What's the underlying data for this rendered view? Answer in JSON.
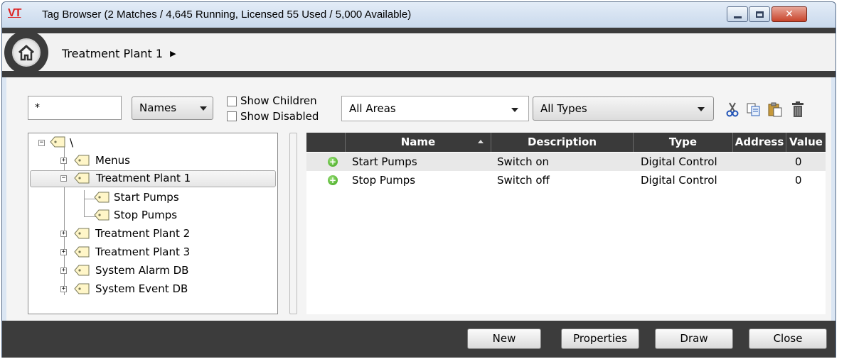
{
  "window": {
    "logo": "VT",
    "title": "Tag Browser (2 Matches / 4,645 Running, Licensed 55 Used / 5,000 Available)",
    "close_glyph": "✕"
  },
  "breadcrumb": {
    "items": [
      "Treatment Plant 1"
    ],
    "arrow": "▶"
  },
  "filters": {
    "search_value": "*",
    "mode_select": "Names",
    "show_children_label": "Show Children",
    "show_disabled_label": "Show Disabled",
    "areas_select": "All Areas",
    "types_select": "All Types"
  },
  "toolbar_icons": [
    "cut-icon",
    "copy-icon",
    "paste-icon",
    "delete-icon"
  ],
  "tree": {
    "root": "\\",
    "items": [
      {
        "label": "Menus",
        "expander": "+"
      },
      {
        "label": "Treatment Plant 1",
        "expander": "−"
      },
      {
        "label": "Start Pumps"
      },
      {
        "label": "Stop Pumps"
      },
      {
        "label": "Treatment Plant 2",
        "expander": "+"
      },
      {
        "label": "Treatment Plant 3",
        "expander": "+"
      },
      {
        "label": "System Alarm DB",
        "expander": "+"
      },
      {
        "label": "System Event DB",
        "expander": "+"
      }
    ]
  },
  "grid": {
    "columns": [
      "Name",
      "Description",
      "Type",
      "Address",
      "Value"
    ],
    "sort_column": "Name",
    "rows": [
      {
        "icon": "+",
        "name": "Start Pumps",
        "description": "Switch on",
        "type": "Digital Control",
        "address": "",
        "value": "0"
      },
      {
        "icon": "+",
        "name": "Stop Pumps",
        "description": "Switch off",
        "type": "Digital Control",
        "address": "",
        "value": "0"
      }
    ]
  },
  "buttons": {
    "new": "New",
    "properties": "Properties",
    "draw": "Draw",
    "close": "Close"
  },
  "colors": {
    "dark_bar": "#3c3c3c",
    "logo_red": "#dd2222",
    "add_green": "#3aa316"
  }
}
